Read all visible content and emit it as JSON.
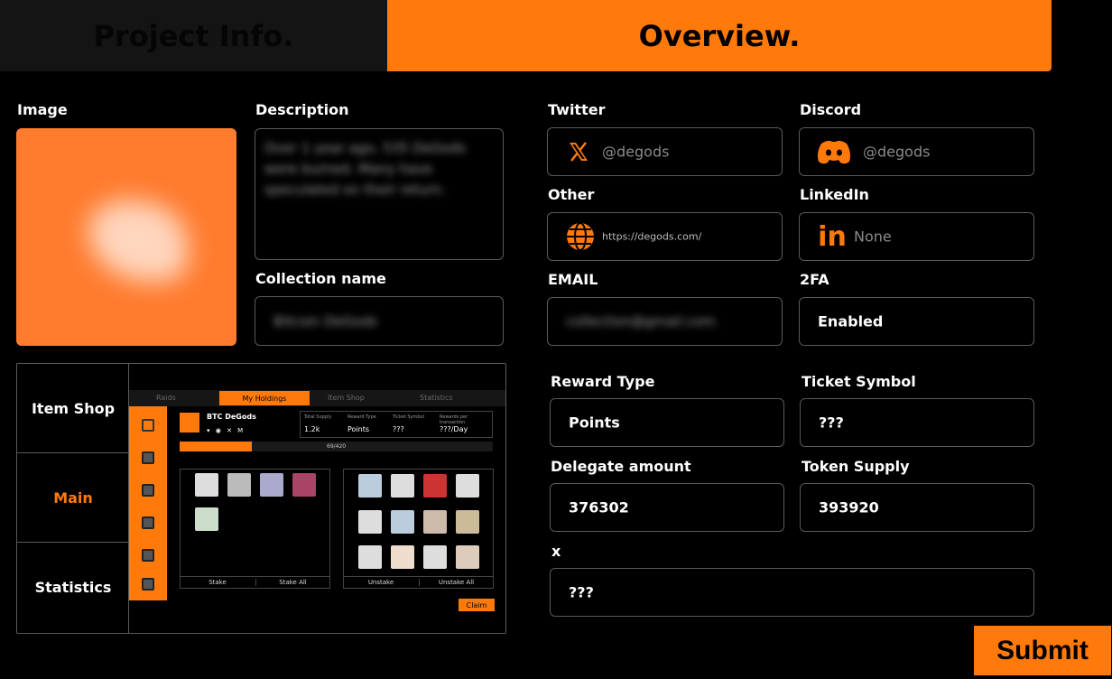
{
  "tabs": {
    "project_info": "Project Info.",
    "overview": "Overview."
  },
  "labels": {
    "image": "Image",
    "description": "Description",
    "collection_name": "Collection name",
    "twitter": "Twitter",
    "discord": "Discord",
    "other": "Other",
    "linkedin": "LinkedIn",
    "email": "EMAIL",
    "twofa": "2FA",
    "reward_type": "Reward Type",
    "ticket_symbol": "Ticket Symbol",
    "delegate_amount": "Delegate amount",
    "token_supply": "Token Supply",
    "x": "x"
  },
  "values": {
    "description": "Over 1 year ago, 535 DeGods were burned. Many have speculated on their return.",
    "collection_name": "Bitcoin DeGods",
    "twitter": "@degods",
    "discord": "@degods",
    "other": "https://degods.com/",
    "linkedin": "None",
    "email": "collection@gmail.com",
    "twofa": "Enabled",
    "reward_type": "Points",
    "ticket_symbol": "???",
    "delegate_amount": "376302",
    "token_supply": "393920",
    "x": "???"
  },
  "preview": {
    "sidebar": [
      "Item Shop",
      "Main",
      "Statistics"
    ],
    "active_sidebar": "Main",
    "tabs": [
      "Raids",
      "My Holdings",
      "Item Shop",
      "Statistics"
    ],
    "collection": "BTC DeGods",
    "stats_headers": [
      "Total Supply",
      "Reward Type",
      "Ticket Symbol",
      "Rewards per transaction"
    ],
    "stats_values": [
      "1.2k",
      "Points",
      "???",
      "???/Day"
    ],
    "progress_label": "69/420",
    "progress": 0.23,
    "left_buttons": [
      "Stake",
      "Stake All"
    ],
    "right_buttons": [
      "Unstake",
      "Unstake All"
    ],
    "claim": "Claim"
  },
  "submit_label": "Submit",
  "colors": {
    "accent": "#ff7a0a",
    "border": "#5a5a5a",
    "background": "#000000"
  },
  "icons": {
    "twitter": "x-logo-icon",
    "discord": "discord-icon",
    "other": "globe-icon",
    "linkedin": "linkedin-icon"
  }
}
